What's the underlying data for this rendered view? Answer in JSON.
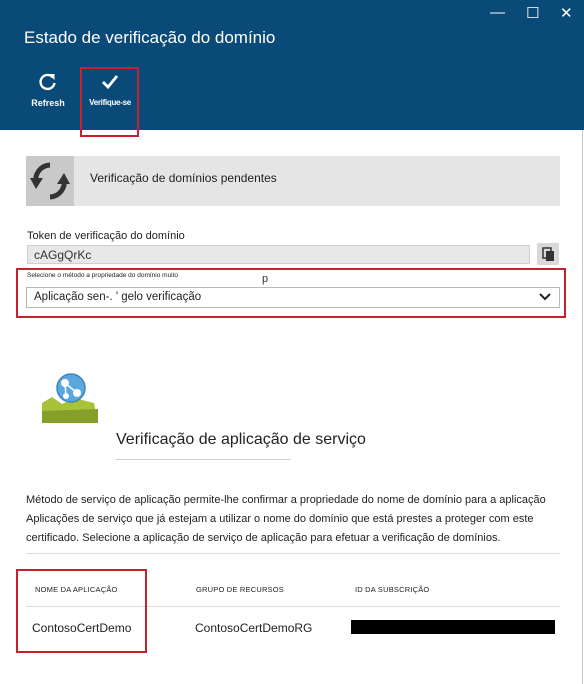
{
  "window": {
    "minimize_glyph": "—",
    "maximize_glyph": "☐",
    "close_glyph": "✕"
  },
  "header": {
    "title": "Estado de verificação do domínio"
  },
  "toolbar": {
    "refresh_label": "Refresh",
    "verify_label": "Verifique-se"
  },
  "pending": {
    "text": "Verificação de domínios pendentes"
  },
  "token": {
    "label": "Token de verificação do domínio",
    "value": "cAGgQrKc"
  },
  "method": {
    "label": "Selecione o método a propriedade do domínio muito",
    "stray": "p",
    "selected": "Aplicação sen-. ' gelo verificação"
  },
  "service": {
    "title": "Verificação de aplicação de serviço",
    "description_lines": [
      "Método de serviço de aplicação permite-lhe confirmar a propriedade do nome de domínio para a aplicação",
      "Aplicações de serviço que já estejam a utilizar o nome do domínio que está prestes a proteger com este",
      "certificado. Selecione a aplicação de serviço de aplicação para efetuar a verificação de domínios."
    ]
  },
  "table": {
    "headers": [
      "NOME DA APLICAÇÃO",
      "GRUPO DE RECURSOS",
      "ID DA SUBSCRIÇÃO"
    ],
    "rows": [
      {
        "app": "ContosoCertDemo",
        "group": "ContosoCertDemoRG"
      }
    ]
  },
  "colors": {
    "header_bg": "#0a4a78",
    "highlight": "#c8202e"
  }
}
